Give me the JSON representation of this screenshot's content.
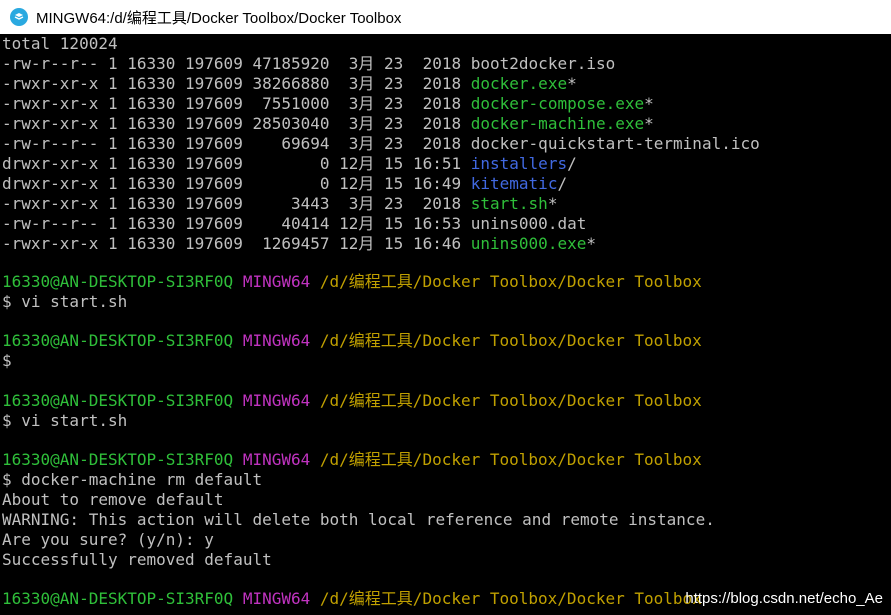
{
  "window": {
    "title": "MINGW64:/d/编程工具/Docker Toolbox/Docker Toolbox"
  },
  "listing": {
    "total": "total 120024",
    "rows": [
      {
        "meta": "-rw-r--r-- 1 16330 197609 47185920  3月 23  2018 ",
        "name": "boot2docker.iso",
        "suffix": "",
        "color": "w"
      },
      {
        "meta": "-rwxr-xr-x 1 16330 197609 38266880  3月 23  2018 ",
        "name": "docker.exe",
        "suffix": "*",
        "color": "g"
      },
      {
        "meta": "-rwxr-xr-x 1 16330 197609  7551000  3月 23  2018 ",
        "name": "docker-compose.exe",
        "suffix": "*",
        "color": "g"
      },
      {
        "meta": "-rwxr-xr-x 1 16330 197609 28503040  3月 23  2018 ",
        "name": "docker-machine.exe",
        "suffix": "*",
        "color": "g"
      },
      {
        "meta": "-rw-r--r-- 1 16330 197609    69694  3月 23  2018 ",
        "name": "docker-quickstart-terminal.ico",
        "suffix": "",
        "color": "w"
      },
      {
        "meta": "drwxr-xr-x 1 16330 197609        0 12月 15 16:51 ",
        "name": "installers",
        "suffix": "/",
        "color": "b"
      },
      {
        "meta": "drwxr-xr-x 1 16330 197609        0 12月 15 16:49 ",
        "name": "kitematic",
        "suffix": "/",
        "color": "b"
      },
      {
        "meta": "-rwxr-xr-x 1 16330 197609     3443  3月 23  2018 ",
        "name": "start.sh",
        "suffix": "*",
        "color": "g"
      },
      {
        "meta": "-rw-r--r-- 1 16330 197609    40414 12月 15 16:53 ",
        "name": "unins000.dat",
        "suffix": "",
        "color": "w"
      },
      {
        "meta": "-rwxr-xr-x 1 16330 197609  1269457 12月 15 16:46 ",
        "name": "unins000.exe",
        "suffix": "*",
        "color": "g"
      }
    ]
  },
  "prompt": {
    "user_host": "16330@AN-DESKTOP-SI3RF0Q",
    "shell": "MINGW64",
    "path": "/d/编程工具/Docker Toolbox/Docker Toolbox"
  },
  "commands": {
    "c1": "$ vi start.sh",
    "c2": "$",
    "c3": "$ vi start.sh",
    "c4": "$ docker-machine rm default"
  },
  "output": {
    "o1": "About to remove default",
    "o2": "WARNING: This action will delete both local reference and remote instance.",
    "o3": "Are you sure? (y/n): y",
    "o4": "Successfully removed default"
  },
  "watermark": "https://blog.csdn.net/echo_Ae",
  "colors": {
    "green": "#2fbf3a",
    "blue": "#4169e1",
    "magenta": "#c033c0",
    "yellow": "#c0a000",
    "text": "#c0c0c0",
    "background": "#000000"
  }
}
